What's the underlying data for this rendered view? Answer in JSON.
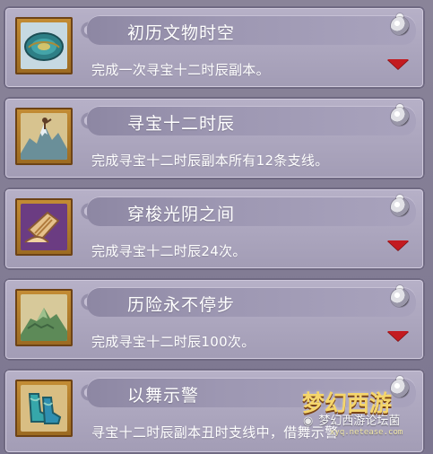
{
  "achievements": [
    {
      "title": "初历文物时空",
      "description": "完成一次寻宝十二时辰副本。",
      "icon": "plate-icon"
    },
    {
      "title": "寻宝十二时辰",
      "description": "完成寻宝十二时辰副本所有12条支线。",
      "icon": "mountain-icon"
    },
    {
      "title": "穿梭光阴之间",
      "description": "完成寻宝十二时辰24次。",
      "icon": "scroll-icon"
    },
    {
      "title": "历险永不停步",
      "description": "完成寻宝十二时辰100次。",
      "icon": "peak-icon"
    },
    {
      "title": "以舞示警",
      "description": "寻宝十二时辰副本丑时支线中，借舞示警",
      "icon": "boots-icon"
    }
  ],
  "logo": {
    "text": "梦幻西游",
    "site": "xyq.netease.com"
  },
  "watermark": "梦幻西游论坛菌",
  "colors": {
    "card_bg": "#a29cb5",
    "title_bar": "#9d97b2",
    "arrow": "#c31b20",
    "frame": "#c48d35"
  }
}
